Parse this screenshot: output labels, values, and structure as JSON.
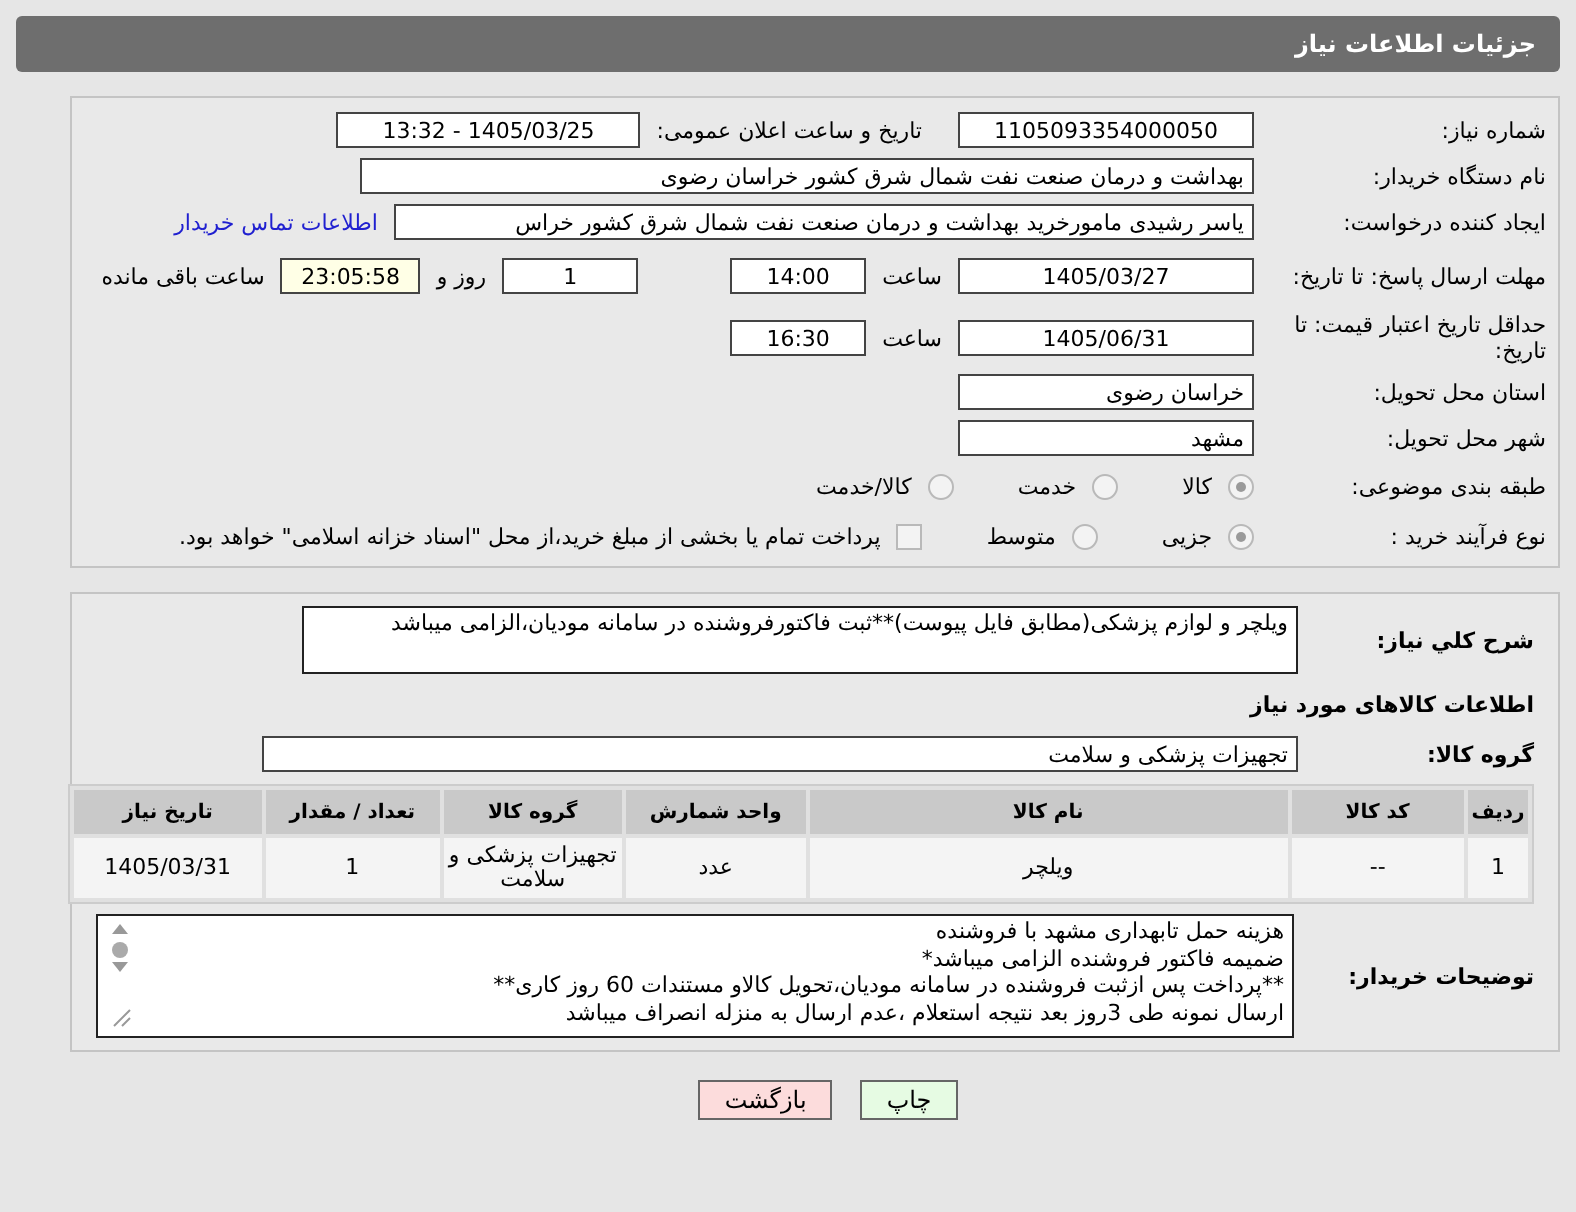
{
  "header": {
    "title": "جزئیات اطلاعات نیاز"
  },
  "need_number": {
    "label": "شماره نیاز:",
    "value": "1105093354000050"
  },
  "announce": {
    "label": "تاریخ و ساعت اعلان عمومی:",
    "value": "1405/03/25 - 13:32"
  },
  "buyer_org": {
    "label": "نام دستگاه خریدار:",
    "value": "بهداشت و درمان صنعت نفت شمال شرق کشور   خراسان رضوی"
  },
  "creator": {
    "label": "ایجاد کننده درخواست:",
    "value": "یاسر رشیدی مامورخرید بهداشت و درمان صنعت نفت شمال شرق کشور   خراس",
    "link": "اطلاعات تماس خریدار"
  },
  "deadline": {
    "label": "مهلت ارسال پاسخ: تا تاریخ:",
    "date": "1405/03/27",
    "time_label": "ساعت",
    "time": "14:00",
    "days": "1",
    "days_label": "روز و",
    "remaining": "23:05:58",
    "remaining_label": "ساعت باقی مانده"
  },
  "validity": {
    "label": "حداقل تاریخ اعتبار قیمت: تا تاریخ:",
    "date": "1405/06/31",
    "time_label": "ساعت",
    "time": "16:30"
  },
  "province": {
    "label": "استان محل تحویل:",
    "value": "خراسان رضوی"
  },
  "city": {
    "label": "شهر محل تحویل:",
    "value": "مشهد"
  },
  "category": {
    "label": "طبقه بندی موضوعی:",
    "options": [
      {
        "label": "کالا",
        "selected": true
      },
      {
        "label": "خدمت",
        "selected": false
      },
      {
        "label": "کالا/خدمت",
        "selected": false
      }
    ]
  },
  "process": {
    "label": "نوع فرآیند خرید :",
    "options": [
      {
        "label": "جزیی",
        "selected": true
      },
      {
        "label": "متوسط",
        "selected": false
      }
    ],
    "checkbox": {
      "checked": false,
      "label": "پرداخت تمام یا بخشی از مبلغ خرید،از محل \"اسناد خزانه اسلامی\" خواهد بود."
    }
  },
  "description": {
    "label": "شرح کلي نياز:",
    "value": "ویلچر و  لوازم پزشکی(مطابق فایل پیوست)**ثبت فاکتورفروشنده در سامانه مودیان،الزامی میباشد"
  },
  "items_title": "اطلاعات کالاهای مورد نیاز",
  "goods_group": {
    "label": "گروه کالا:",
    "value": "تجهیزات پزشکی و سلامت"
  },
  "table": {
    "columns": [
      "ردیف",
      "کد کالا",
      "نام کالا",
      "واحد شمارش",
      "گروه کالا",
      "تعداد / مقدار",
      "تاریخ نیاز"
    ],
    "rows": [
      [
        "1",
        "--",
        "ویلچر",
        "عدد",
        "تجهیزات پزشکی و سلامت",
        "1",
        "1405/03/31"
      ]
    ]
  },
  "buyer_notes": {
    "label": "توضیحات خریدار:",
    "lines": [
      "هزینه حمل تابهداری مشهد با فروشنده",
      "ضمیمه فاکتور فروشنده الزامی میباشد*",
      "**پرداخت پس ازثبت فروشنده در سامانه مودیان،تحویل کالاو مستندات 60 روز کاری**",
      "ارسال نمونه طی 3روز بعد نتیجه استعلام ،عدم ارسال به منزله انصراف میباشد"
    ]
  },
  "buttons": [
    {
      "label": "چاپ",
      "kind": "print"
    },
    {
      "label": "بازگشت",
      "kind": "back"
    }
  ]
}
